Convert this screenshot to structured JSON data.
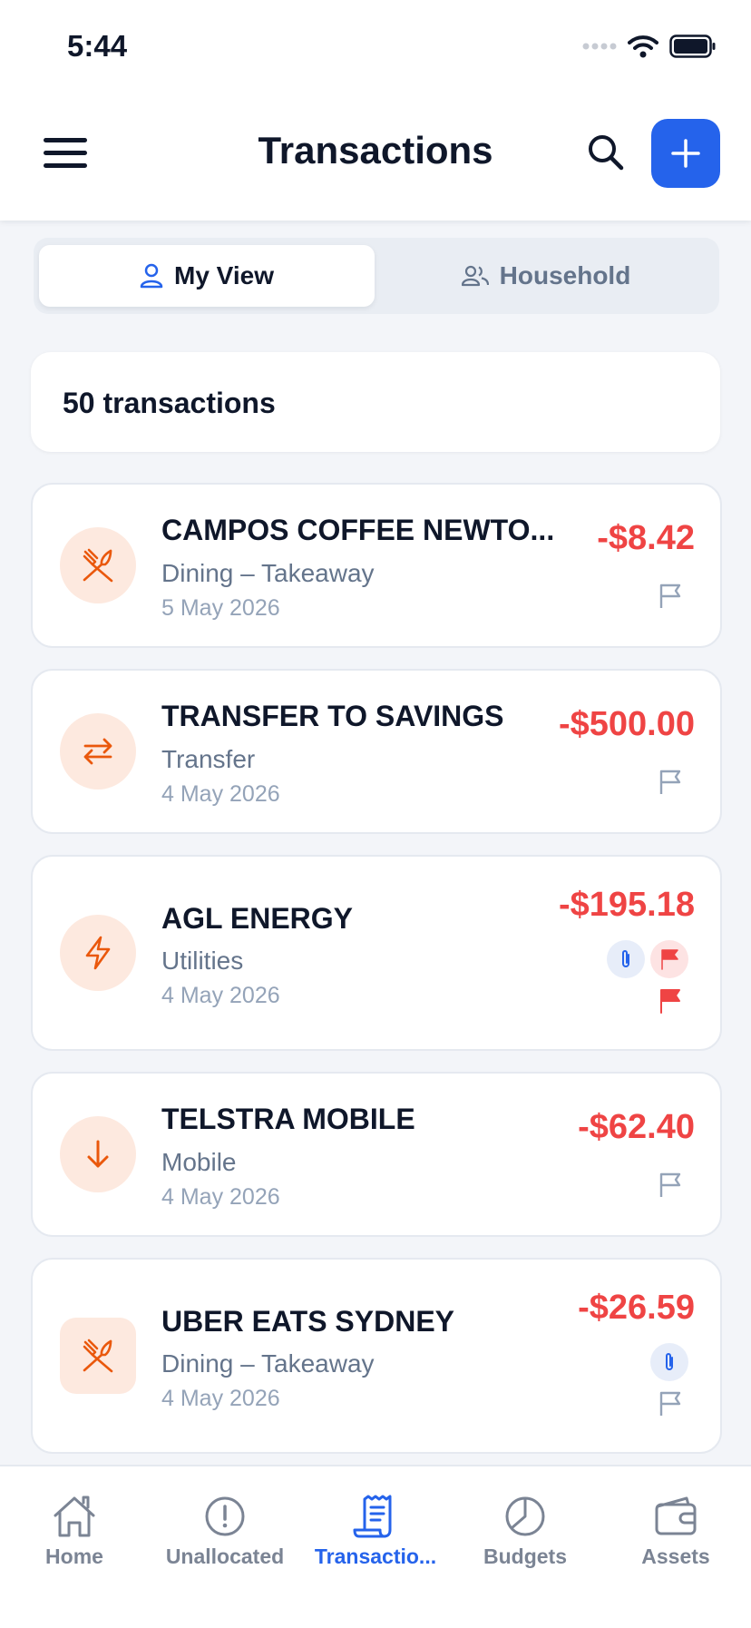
{
  "status": {
    "time": "5:44"
  },
  "header": {
    "title": "Transactions"
  },
  "view_toggle": {
    "my_view": "My View",
    "household": "Household"
  },
  "summary": {
    "count_text": "50 transactions"
  },
  "transactions": [
    {
      "name": "CAMPOS COFFEE NEWTO...",
      "category": "Dining – Takeaway",
      "date": "5 May 2026",
      "amount": "-$8.42",
      "icon": "fork-knife-icon"
    },
    {
      "name": "TRANSFER TO SAVINGS",
      "category": "Transfer",
      "date": "4 May 2026",
      "amount": "-$500.00",
      "icon": "transfer-arrows-icon"
    },
    {
      "name": "AGL ENERGY",
      "category": "Utilities",
      "date": "4 May 2026",
      "amount": "-$195.18",
      "icon": "lightning-icon"
    },
    {
      "name": "TELSTRA MOBILE",
      "category": "Mobile",
      "date": "4 May 2026",
      "amount": "-$62.40",
      "icon": "arrow-down-icon"
    },
    {
      "name": "UBER EATS SYDNEY",
      "category": "Dining – Takeaway",
      "date": "4 May 2026",
      "amount": "-$26.59",
      "icon": "fork-knife-icon"
    }
  ],
  "tabs": [
    {
      "label": "Home",
      "icon": "home-icon"
    },
    {
      "label": "Unallocated",
      "icon": "alert-circle-icon"
    },
    {
      "label": "Transactio...",
      "icon": "receipt-icon"
    },
    {
      "label": "Budgets",
      "icon": "pie-chart-icon"
    },
    {
      "label": "Assets",
      "icon": "wallet-icon"
    }
  ],
  "colors": {
    "accent": "#2563eb",
    "negative": "#ef4444",
    "icon_orange": "#ea580c",
    "icon_bg": "#fde9df"
  }
}
